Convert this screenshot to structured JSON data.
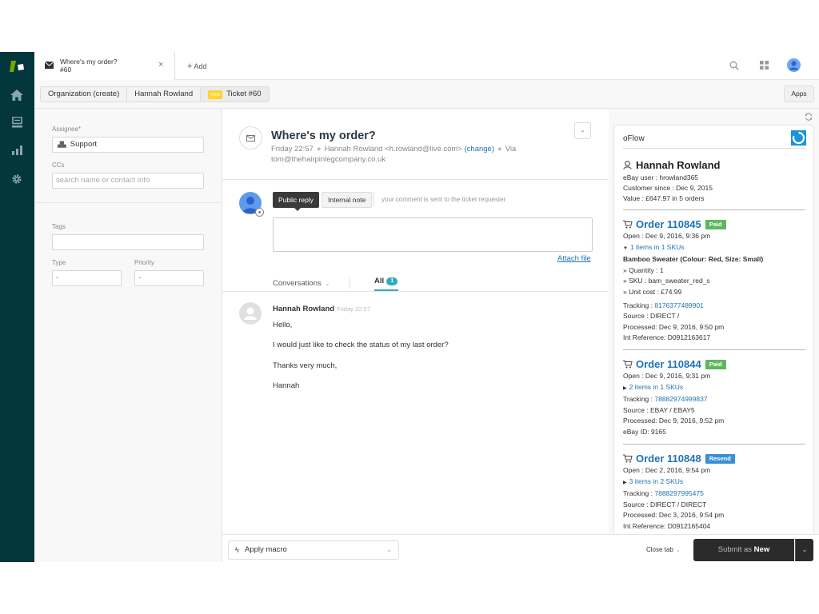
{
  "nav": {
    "items": [
      {
        "name": "home",
        "icon": "home-icon"
      },
      {
        "name": "views",
        "icon": "views-icon"
      },
      {
        "name": "reporting",
        "icon": "bar-chart-icon"
      },
      {
        "name": "admin",
        "icon": "gear-icon"
      }
    ]
  },
  "topbar": {
    "tab": {
      "title": "Where's my order?",
      "subtitle": "#60",
      "close": "×"
    },
    "add_label": "Add",
    "add_icon": "+"
  },
  "ctxbar": {
    "crumbs": [
      "Organization (create)",
      "Hannah Rowland",
      "Ticket #60"
    ],
    "new_badge": "new",
    "apps_label": "Apps"
  },
  "props": {
    "assignee_label": "Assignee*",
    "assignee_value": "Support",
    "ccs_label": "CCs",
    "ccs_placeholder": "search name or contact info",
    "tags_label": "Tags",
    "tags_value": "",
    "type_label": "Type",
    "type_value": "-",
    "priority_label": "Priority",
    "priority_value": "-"
  },
  "ticket": {
    "subject": "Where's my order?",
    "time": "Friday 22:57",
    "requester": "Hannah Rowland <h.rowland@live.com>",
    "change_label": "(change)",
    "via_label": "Via",
    "via_email": "tom@thehairpinlegcompany.co.uk",
    "public_reply_label": "Public reply",
    "internal_note_label": "Internal note",
    "reply_hint": "your comment is sent to the ticket requester",
    "reply_value": "",
    "attach_label": "Attach file",
    "conversations_label": "Conversations",
    "all_label": "All",
    "all_count": "1"
  },
  "message": {
    "author": "Hannah Rowland",
    "time": "Friday 22:57",
    "lines": [
      "Hello,",
      "I would just like to check the status of my last order?",
      "Thanks very much,",
      "Hannah"
    ]
  },
  "footer": {
    "macro_label": "Apply macro",
    "close_tab_label": "Close tab",
    "submit_prefix": "Submit as",
    "submit_status": "New"
  },
  "oflow": {
    "title": "oFlow",
    "customer": {
      "name": "Hannah Rowland",
      "ebay_user": "eBay user : hrowland365",
      "since": "Customer since : Dec 9, 2015",
      "value": "Value : £647.97 in 5 orders"
    },
    "orders": [
      {
        "number": "Order 110845",
        "status": "Paid",
        "status_color": "#5cb85c",
        "open": "Open : Dec 9, 2016, 9:36 pm",
        "items": "1 items in 1 SKUs",
        "expanded": true,
        "item_title": "Bamboo Sweater (Colour: Red, Size: Small)",
        "item_details": [
          "» Quantity : 1",
          "» SKU : bam_sweater_red_s",
          "» Unit cost : £74.99"
        ],
        "tracking_label": "Tracking : ",
        "tracking": "8176377489901",
        "source": "Source : DIRECT /",
        "processed": "Processed: Dec 9, 2016, 9:50 pm",
        "extra": "Int Reference: D0912163617"
      },
      {
        "number": "Order 110844",
        "status": "Paid",
        "status_color": "#5cb85c",
        "open": "Open : Dec 9, 2016, 9:31 pm",
        "items": "2 items in 1 SKUs",
        "expanded": false,
        "tracking_label": "Tracking : ",
        "tracking": "78882974999837",
        "source": "Source : EBAY / EBAY5",
        "processed": "Processed: Dec 9, 2016, 9:52 pm",
        "extra": "eBay ID: 9165"
      },
      {
        "number": "Order 110848",
        "status": "Resend",
        "status_color": "#3a8fd6",
        "open": "Open : Dec 2, 2016, 9:54 pm",
        "items": "3 items in 2 SKUs",
        "expanded": false,
        "tracking_label": "Tracking : ",
        "tracking": "7888297995475",
        "source": "Source : DIRECT / DIRECT",
        "processed": "Processed: Dec 3, 2016, 9:54 pm",
        "extra": "Int Reference: D0912165404"
      }
    ]
  }
}
